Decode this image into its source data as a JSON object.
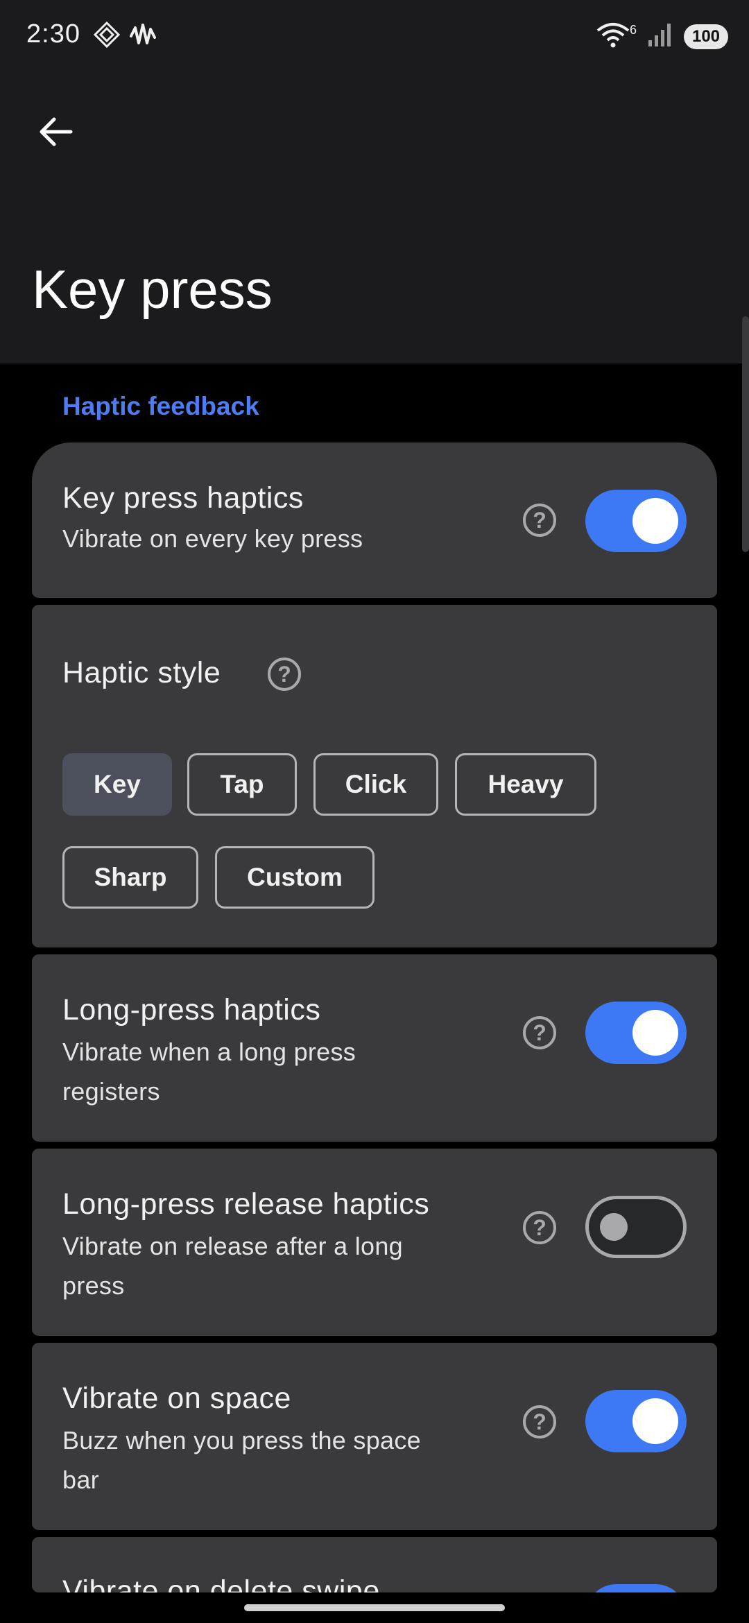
{
  "status_bar": {
    "time": "2:30",
    "battery": "100",
    "network_badge": "6"
  },
  "app_bar": {
    "title": "Key press"
  },
  "section": {
    "label": "Haptic feedback"
  },
  "settings": {
    "key_press": {
      "title": "Key press haptics",
      "subtitle": "Vibrate on every key press",
      "enabled": true
    },
    "haptic_style": {
      "title": "Haptic style",
      "options": [
        "Key",
        "Tap",
        "Click",
        "Heavy",
        "Sharp",
        "Custom"
      ],
      "selected": "Key"
    },
    "long_press": {
      "title": "Long-press haptics",
      "subtitle_line1": "Vibrate when a long press",
      "subtitle_line2": "registers",
      "enabled": true
    },
    "long_press_release": {
      "title": "Long-press release haptics",
      "subtitle_line1": "Vibrate on release after a long",
      "subtitle_line2": "press",
      "enabled": false
    },
    "vibrate_space": {
      "title": "Vibrate on space",
      "subtitle_line1": "Buzz when you press the space",
      "subtitle_line2": "bar",
      "enabled": true
    },
    "vibrate_delete_swipe": {
      "title": "Vibrate on delete swipe",
      "enabled": true
    }
  },
  "colors": {
    "accent": "#3d78f5",
    "section_label": "#4d7cf5",
    "card": "#3a3a3c",
    "background": "#000000"
  }
}
